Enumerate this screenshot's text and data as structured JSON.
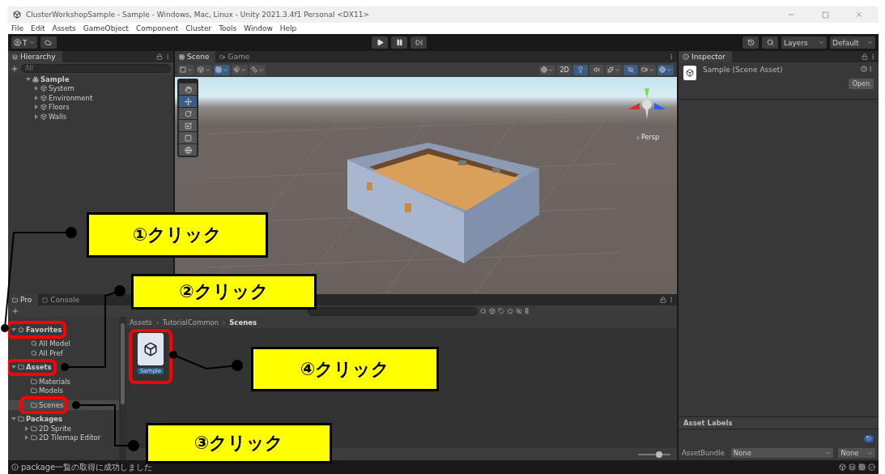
{
  "window": {
    "title": "ClusterWorkshopSample - Sample - Windows, Mac, Linux - Unity 2021.3.4f1 Personal <DX11>"
  },
  "menu": [
    "File",
    "Edit",
    "Assets",
    "GameObject",
    "Component",
    "Cluster",
    "Tools",
    "Window",
    "Help"
  ],
  "toolbar": {
    "account": "T",
    "layers": "Layers",
    "layout": "Default"
  },
  "hierarchy": {
    "tab": "Hierarchy",
    "search_placeholder": "All",
    "tree": [
      {
        "label": "Sample",
        "kind": "scene",
        "expanded": true,
        "children": [
          {
            "label": "System",
            "kind": "object",
            "expanded": false
          },
          {
            "label": "Environment",
            "kind": "object",
            "expanded": false
          },
          {
            "label": "Floors",
            "kind": "object",
            "expanded": false
          },
          {
            "label": "Walls",
            "kind": "object",
            "expanded": false
          }
        ]
      }
    ]
  },
  "scene_view": {
    "tabs": [
      {
        "label": "Scene",
        "selected": true
      },
      {
        "label": "Game",
        "selected": false
      }
    ],
    "toolbar_buttons": [
      {
        "kind": "draw_mode",
        "on": false
      },
      {
        "kind": "shading",
        "on": false
      },
      {
        "kind": "grid",
        "on": true
      },
      {
        "kind": "snap",
        "on": false
      },
      {
        "kind": "increment",
        "on": false
      },
      {
        "kind": "gizmo_toggle",
        "on": false
      },
      {
        "kind": "mode_2d",
        "label": "2D",
        "on": false
      },
      {
        "kind": "lighting",
        "on": true
      },
      {
        "kind": "audio",
        "on": false
      },
      {
        "kind": "effects",
        "on": false
      },
      {
        "kind": "visibility",
        "on": true
      },
      {
        "kind": "camera",
        "on": false
      },
      {
        "kind": "gizmos",
        "on": true
      }
    ],
    "projection": "Persp",
    "tools": [
      {
        "kind": "hand",
        "selected": false
      },
      {
        "kind": "move",
        "selected": true
      },
      {
        "kind": "rotate",
        "selected": false
      },
      {
        "kind": "scale",
        "selected": false
      },
      {
        "kind": "rect",
        "selected": false
      },
      {
        "kind": "transform",
        "selected": false
      }
    ]
  },
  "inspector": {
    "tab": "Inspector",
    "asset": "Sample (Scene Asset)",
    "open_button": "Open",
    "labels_title": "Asset Labels",
    "bundle_label": "AssetBundle",
    "bundle_value": "None",
    "variant_value": "None"
  },
  "project": {
    "tabs": [
      {
        "label": "Pro",
        "selected": true
      },
      {
        "label": "Console",
        "selected": false
      }
    ],
    "tree": [
      {
        "label": "Favorites",
        "kind": "favorites",
        "expanded": true,
        "selected": false,
        "highlighted": true,
        "children": [
          {
            "label": "All Model",
            "kind": "search",
            "selected": false,
            "highlighted": false
          },
          {
            "label": "All Pref",
            "kind": "search",
            "selected": false,
            "highlighted": false
          }
        ]
      },
      {
        "label": "Assets",
        "kind": "folder",
        "expanded": true,
        "selected": false,
        "highlighted": true,
        "children": [
          {
            "label": "Materials",
            "kind": "folder",
            "selected": false,
            "highlighted": false
          },
          {
            "label": "Models",
            "kind": "folder",
            "selected": false,
            "highlighted": false
          },
          {
            "label": "Scenes",
            "kind": "folder",
            "selected": true,
            "highlighted": true
          }
        ]
      },
      {
        "label": "Packages",
        "kind": "folder",
        "expanded": true,
        "selected": false,
        "highlighted": false,
        "children": [
          {
            "label": "2D Sprite",
            "kind": "folder",
            "expanded": false,
            "selected": false,
            "highlighted": false
          },
          {
            "label": "2D Tilemap Editor",
            "kind": "folder",
            "expanded": false,
            "selected": false,
            "highlighted": false
          }
        ]
      }
    ],
    "breadcrumb": [
      "Assets",
      "TutorialCommon",
      "Scenes"
    ],
    "hidden_count": "8",
    "assets": [
      {
        "label": "Sample",
        "selected": true,
        "highlighted": true
      }
    ],
    "zoom_slider": {
      "level": 0.7
    }
  },
  "status_bar": {
    "message": "package一覧の取得に成功しました"
  },
  "callouts": [
    {
      "label": "①クリック"
    },
    {
      "label": "②クリック"
    },
    {
      "label": "③クリック"
    },
    {
      "label": "④クリック"
    }
  ]
}
